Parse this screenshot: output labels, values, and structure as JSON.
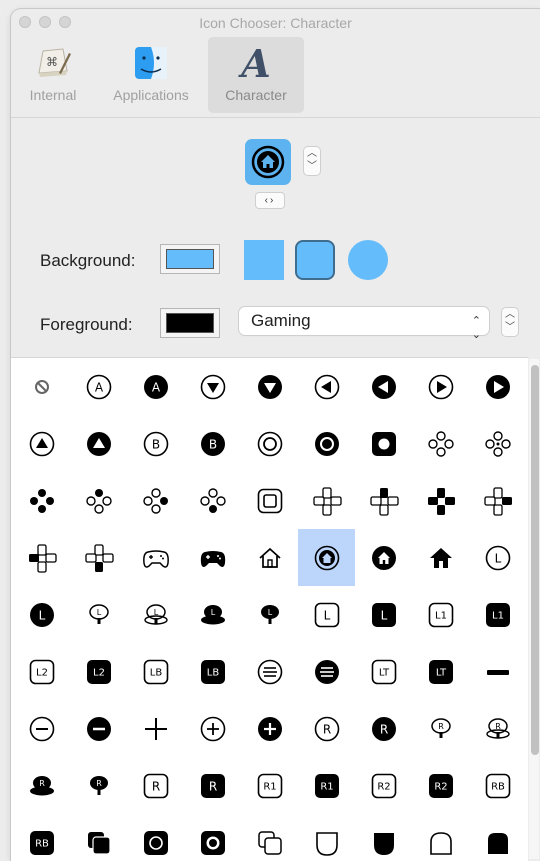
{
  "window": {
    "title": "Icon Chooser: Character"
  },
  "toolbar": {
    "items": [
      {
        "label": "Internal",
        "icon": "keyboard-command-icon"
      },
      {
        "label": "Applications",
        "icon": "finder-icon"
      },
      {
        "label": "Character",
        "icon": "font-a-icon",
        "selected": true
      }
    ]
  },
  "preview": {
    "icon": "home-circle-icon",
    "background_color": "#5CB3F0"
  },
  "background": {
    "label": "Background:",
    "color": "#65BCFA",
    "shapes": [
      "square",
      "rounded-square",
      "circle"
    ],
    "selected_shape": "rounded-square"
  },
  "foreground": {
    "label": "Foreground:",
    "color": "#000000",
    "font_set": "Gaming"
  },
  "colors": {
    "accent": "#65BCFA",
    "selection": "#BCD6FB"
  },
  "glyph_grid": {
    "selected_index": 32,
    "rows": [
      [
        "no-entry-icon",
        "circle-a-outline-icon",
        "circle-a-filled-icon",
        "triangle-down-outline-icon",
        "triangle-down-filled-icon",
        "triangle-left-outline-icon",
        "triangle-left-filled-icon",
        "triangle-right-outline-icon",
        "triangle-right-filled-icon"
      ],
      [
        "triangle-up-outline-icon",
        "triangle-up-filled-icon",
        "circle-b-outline-icon",
        "circle-b-filled-icon",
        "circle-ring-outline-icon",
        "circle-ring-filled-icon",
        "square-circle-filled-icon",
        "dpad-circles-outline-icon",
        "dpad-circles-dots-icon"
      ],
      [
        "dpad-circles-filled-icon",
        "dpad-circles-top-icon",
        "dpad-circles-right-icon",
        "dpad-circles-bottom-icon",
        "square-circle-outline-icon",
        "dpad-cross-outline-icon",
        "dpad-cross-up-icon",
        "dpad-cross-filled-icon",
        "dpad-cross-right-icon"
      ],
      [
        "dpad-cross-left-icon",
        "dpad-cross-down-icon",
        "gamecontroller-outline-icon",
        "gamecontroller-filled-icon",
        "house-outline-icon",
        "house-circle-outline-icon",
        "house-circle-filled-icon",
        "house-filled-icon",
        "circle-l-outline-icon"
      ],
      [
        "circle-l-filled-icon",
        "joystick-l-icon",
        "joystick-l-ring-icon",
        "joystick-l-dark-icon",
        "joystick-l-filled-icon",
        "square-l-outline-icon",
        "square-l-filled-icon",
        "square-l1-outline-icon",
        "square-l1-filled-icon"
      ],
      [
        "square-l2-outline-icon",
        "square-l2-filled-icon",
        "square-lb-outline-icon",
        "square-lb-filled-icon",
        "circle-lines-outline-icon",
        "circle-lines-filled-icon",
        "square-lt-outline-icon",
        "square-lt-filled-icon",
        "minus-bar-icon"
      ],
      [
        "circle-minus-outline-icon",
        "circle-minus-filled-icon",
        "plus-icon",
        "circle-plus-outline-icon",
        "circle-plus-filled-icon",
        "circle-r-outline-icon",
        "circle-r-filled-icon",
        "joystick-r-icon",
        "joystick-r-ring-icon"
      ],
      [
        "joystick-r-dark-icon",
        "joystick-r-filled-icon",
        "square-r-outline-icon",
        "square-r-filled-icon",
        "square-r1-outline-icon",
        "square-r1-filled-icon",
        "square-r2-outline-icon",
        "square-r2-filled-icon",
        "square-rb-outline-icon"
      ],
      [
        "square-rb-filled-icon",
        "squares-stack-filled-icon",
        "squares-stack-circle-icon",
        "squares-stack-circle-filled-icon",
        "squares-stack-outline-icon",
        "trigger-outline-icon",
        "trigger-filled-icon",
        "bumper-outline-icon",
        "bumper-filled-icon"
      ]
    ]
  }
}
